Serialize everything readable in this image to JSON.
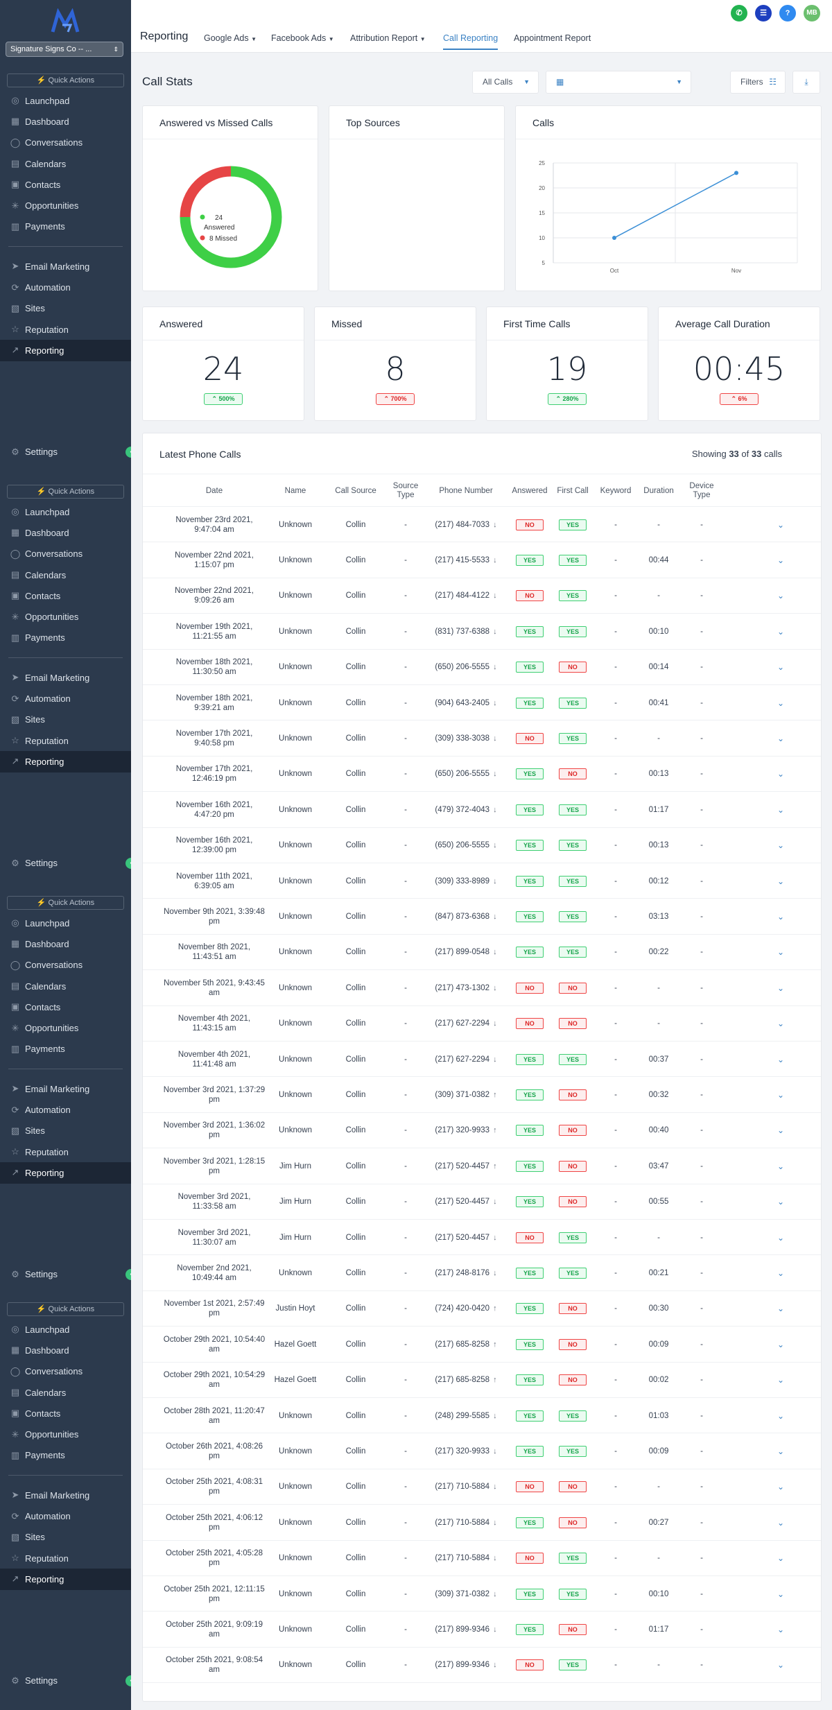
{
  "sidebar": {
    "logo": "MB",
    "account": "Signature Signs Co -- ...",
    "quick_actions": "Quick Actions",
    "group1": [
      {
        "label": "Launchpad",
        "icon": "launchpad-icon"
      },
      {
        "label": "Dashboard",
        "icon": "dashboard-icon"
      },
      {
        "label": "Conversations",
        "icon": "conversations-icon"
      },
      {
        "label": "Calendars",
        "icon": "calendar-icon"
      },
      {
        "label": "Contacts",
        "icon": "contacts-icon"
      },
      {
        "label": "Opportunities",
        "icon": "opportunities-icon"
      },
      {
        "label": "Payments",
        "icon": "payments-icon"
      }
    ],
    "group2": [
      {
        "label": "Email Marketing",
        "icon": "email-icon"
      },
      {
        "label": "Automation",
        "icon": "automation-icon"
      },
      {
        "label": "Sites",
        "icon": "sites-icon"
      },
      {
        "label": "Reputation",
        "icon": "star-icon"
      },
      {
        "label": "Reporting",
        "icon": "reporting-icon"
      }
    ],
    "settings": "Settings"
  },
  "topbar": {
    "title": "Reporting",
    "tabs": [
      "Google Ads",
      "Facebook Ads",
      "Attribution Report",
      "Call Reporting",
      "Appointment Report"
    ],
    "active_tab": 3,
    "avatar_initials": "MB",
    "help": "?"
  },
  "controls": {
    "page_title": "Call Stats",
    "call_filter": "All Calls",
    "filters_label": "Filters"
  },
  "cards": {
    "answered_vs_missed": {
      "title": "Answered vs Missed Calls",
      "answered_legend": "24 Answered",
      "missed_legend": "8 Missed",
      "answered": 24,
      "missed": 8
    },
    "top_sources": {
      "title": "Top Sources"
    },
    "calls": {
      "title": "Calls"
    }
  },
  "stats": [
    {
      "title": "Answered",
      "value": "24",
      "change": "500%",
      "dir": "up"
    },
    {
      "title": "Missed",
      "value": "8",
      "change": "700%",
      "dir": "down"
    },
    {
      "title": "First Time Calls",
      "value": "19",
      "change": "280%",
      "dir": "up"
    },
    {
      "title": "Average Call Duration",
      "value": "00:45",
      "change": "6%",
      "dir": "down"
    }
  ],
  "latest": {
    "title": "Latest Phone Calls",
    "showing_prefix": "Showing",
    "showing_count": "33",
    "showing_of": "of",
    "showing_total": "33",
    "showing_suffix": "calls",
    "columns": [
      "Date",
      "Name",
      "Call Source",
      "Source Type",
      "Phone Number",
      "Answered",
      "First Call",
      "Keyword",
      "Duration",
      "Device Type"
    ],
    "rows": [
      {
        "date": "November 23rd 2021, 9:47:04 am",
        "name": "Unknown",
        "source": "Collin",
        "type": "-",
        "phone": "(217) 484-7033",
        "dir": "in",
        "answered": "NO",
        "first": "YES",
        "keyword": "-",
        "duration": "-",
        "device": "-"
      },
      {
        "date": "November 22nd 2021, 1:15:07 pm",
        "name": "Unknown",
        "source": "Collin",
        "type": "-",
        "phone": "(217) 415-5533",
        "dir": "in",
        "answered": "YES",
        "first": "YES",
        "keyword": "-",
        "duration": "00:44",
        "device": "-"
      },
      {
        "date": "November 22nd 2021, 9:09:26 am",
        "name": "Unknown",
        "source": "Collin",
        "type": "-",
        "phone": "(217) 484-4122",
        "dir": "in",
        "answered": "NO",
        "first": "YES",
        "keyword": "-",
        "duration": "-",
        "device": "-"
      },
      {
        "date": "November 19th 2021, 11:21:55 am",
        "name": "Unknown",
        "source": "Collin",
        "type": "-",
        "phone": "(831) 737-6388",
        "dir": "in",
        "answered": "YES",
        "first": "YES",
        "keyword": "-",
        "duration": "00:10",
        "device": "-"
      },
      {
        "date": "November 18th 2021, 11:30:50 am",
        "name": "Unknown",
        "source": "Collin",
        "type": "-",
        "phone": "(650) 206-5555",
        "dir": "in",
        "answered": "YES",
        "first": "NO",
        "keyword": "-",
        "duration": "00:14",
        "device": "-"
      },
      {
        "date": "November 18th 2021, 9:39:21 am",
        "name": "Unknown",
        "source": "Collin",
        "type": "-",
        "phone": "(904) 643-2405",
        "dir": "in",
        "answered": "YES",
        "first": "YES",
        "keyword": "-",
        "duration": "00:41",
        "device": "-"
      },
      {
        "date": "November 17th 2021, 9:40:58 pm",
        "name": "Unknown",
        "source": "Collin",
        "type": "-",
        "phone": "(309) 338-3038",
        "dir": "in",
        "answered": "NO",
        "first": "YES",
        "keyword": "-",
        "duration": "-",
        "device": "-"
      },
      {
        "date": "November 17th 2021, 12:46:19 pm",
        "name": "Unknown",
        "source": "Collin",
        "type": "-",
        "phone": "(650) 206-5555",
        "dir": "in",
        "answered": "YES",
        "first": "NO",
        "keyword": "-",
        "duration": "00:13",
        "device": "-"
      },
      {
        "date": "November 16th 2021, 4:47:20 pm",
        "name": "Unknown",
        "source": "Collin",
        "type": "-",
        "phone": "(479) 372-4043",
        "dir": "in",
        "answered": "YES",
        "first": "YES",
        "keyword": "-",
        "duration": "01:17",
        "device": "-"
      },
      {
        "date": "November 16th 2021, 12:39:00 pm",
        "name": "Unknown",
        "source": "Collin",
        "type": "-",
        "phone": "(650) 206-5555",
        "dir": "in",
        "answered": "YES",
        "first": "YES",
        "keyword": "-",
        "duration": "00:13",
        "device": "-"
      },
      {
        "date": "November 11th 2021, 6:39:05 am",
        "name": "Unknown",
        "source": "Collin",
        "type": "-",
        "phone": "(309) 333-8989",
        "dir": "in",
        "answered": "YES",
        "first": "YES",
        "keyword": "-",
        "duration": "00:12",
        "device": "-"
      },
      {
        "date": "November 9th 2021, 3:39:48 pm",
        "name": "Unknown",
        "source": "Collin",
        "type": "-",
        "phone": "(847) 873-6368",
        "dir": "in",
        "answered": "YES",
        "first": "YES",
        "keyword": "-",
        "duration": "03:13",
        "device": "-"
      },
      {
        "date": "November 8th 2021, 11:43:51 am",
        "name": "Unknown",
        "source": "Collin",
        "type": "-",
        "phone": "(217) 899-0548",
        "dir": "in",
        "answered": "YES",
        "first": "YES",
        "keyword": "-",
        "duration": "00:22",
        "device": "-"
      },
      {
        "date": "November 5th 2021, 9:43:45 am",
        "name": "Unknown",
        "source": "Collin",
        "type": "-",
        "phone": "(217) 473-1302",
        "dir": "in",
        "answered": "NO",
        "first": "NO",
        "keyword": "-",
        "duration": "-",
        "device": "-"
      },
      {
        "date": "November 4th 2021, 11:43:15 am",
        "name": "Unknown",
        "source": "Collin",
        "type": "-",
        "phone": "(217) 627-2294",
        "dir": "in",
        "answered": "NO",
        "first": "NO",
        "keyword": "-",
        "duration": "-",
        "device": "-"
      },
      {
        "date": "November 4th 2021, 11:41:48 am",
        "name": "Unknown",
        "source": "Collin",
        "type": "-",
        "phone": "(217) 627-2294",
        "dir": "in",
        "answered": "YES",
        "first": "YES",
        "keyword": "-",
        "duration": "00:37",
        "device": "-"
      },
      {
        "date": "November 3rd 2021, 1:37:29 pm",
        "name": "Unknown",
        "source": "Collin",
        "type": "-",
        "phone": "(309) 371-0382",
        "dir": "out",
        "answered": "YES",
        "first": "NO",
        "keyword": "-",
        "duration": "00:32",
        "device": "-"
      },
      {
        "date": "November 3rd 2021, 1:36:02 pm",
        "name": "Unknown",
        "source": "Collin",
        "type": "-",
        "phone": "(217) 320-9933",
        "dir": "out",
        "answered": "YES",
        "first": "NO",
        "keyword": "-",
        "duration": "00:40",
        "device": "-"
      },
      {
        "date": "November 3rd 2021, 1:28:15 pm",
        "name": "Jim Hurn",
        "source": "Collin",
        "type": "-",
        "phone": "(217) 520-4457",
        "dir": "out",
        "answered": "YES",
        "first": "NO",
        "keyword": "-",
        "duration": "03:47",
        "device": "-"
      },
      {
        "date": "November 3rd 2021, 11:33:58 am",
        "name": "Jim Hurn",
        "source": "Collin",
        "type": "-",
        "phone": "(217) 520-4457",
        "dir": "in",
        "answered": "YES",
        "first": "NO",
        "keyword": "-",
        "duration": "00:55",
        "device": "-"
      },
      {
        "date": "November 3rd 2021, 11:30:07 am",
        "name": "Jim Hurn",
        "source": "Collin",
        "type": "-",
        "phone": "(217) 520-4457",
        "dir": "in",
        "answered": "NO",
        "first": "YES",
        "keyword": "-",
        "duration": "-",
        "device": "-"
      },
      {
        "date": "November 2nd 2021, 10:49:44 am",
        "name": "Unknown",
        "source": "Collin",
        "type": "-",
        "phone": "(217) 248-8176",
        "dir": "in",
        "answered": "YES",
        "first": "YES",
        "keyword": "-",
        "duration": "00:21",
        "device": "-"
      },
      {
        "date": "November 1st 2021, 2:57:49 pm",
        "name": "Justin Hoyt",
        "source": "Collin",
        "type": "-",
        "phone": "(724) 420-0420",
        "dir": "out",
        "answered": "YES",
        "first": "NO",
        "keyword": "-",
        "duration": "00:30",
        "device": "-"
      },
      {
        "date": "October 29th 2021, 10:54:40 am",
        "name": "Hazel Goett",
        "source": "Collin",
        "type": "-",
        "phone": "(217) 685-8258",
        "dir": "out",
        "answered": "YES",
        "first": "NO",
        "keyword": "-",
        "duration": "00:09",
        "device": "-"
      },
      {
        "date": "October 29th 2021, 10:54:29 am",
        "name": "Hazel Goett",
        "source": "Collin",
        "type": "-",
        "phone": "(217) 685-8258",
        "dir": "out",
        "answered": "YES",
        "first": "NO",
        "keyword": "-",
        "duration": "00:02",
        "device": "-"
      },
      {
        "date": "October 28th 2021, 11:20:47 am",
        "name": "Unknown",
        "source": "Collin",
        "type": "-",
        "phone": "(248) 299-5585",
        "dir": "in",
        "answered": "YES",
        "first": "YES",
        "keyword": "-",
        "duration": "01:03",
        "device": "-"
      },
      {
        "date": "October 26th 2021, 4:08:26 pm",
        "name": "Unknown",
        "source": "Collin",
        "type": "-",
        "phone": "(217) 320-9933",
        "dir": "in",
        "answered": "YES",
        "first": "YES",
        "keyword": "-",
        "duration": "00:09",
        "device": "-"
      },
      {
        "date": "October 25th 2021, 4:08:31 pm",
        "name": "Unknown",
        "source": "Collin",
        "type": "-",
        "phone": "(217) 710-5884",
        "dir": "in",
        "answered": "NO",
        "first": "NO",
        "keyword": "-",
        "duration": "-",
        "device": "-"
      },
      {
        "date": "October 25th 2021, 4:06:12 pm",
        "name": "Unknown",
        "source": "Collin",
        "type": "-",
        "phone": "(217) 710-5884",
        "dir": "in",
        "answered": "YES",
        "first": "NO",
        "keyword": "-",
        "duration": "00:27",
        "device": "-"
      },
      {
        "date": "October 25th 2021, 4:05:28 pm",
        "name": "Unknown",
        "source": "Collin",
        "type": "-",
        "phone": "(217) 710-5884",
        "dir": "in",
        "answered": "NO",
        "first": "YES",
        "keyword": "-",
        "duration": "-",
        "device": "-"
      },
      {
        "date": "October 25th 2021, 12:11:15 pm",
        "name": "Unknown",
        "source": "Collin",
        "type": "-",
        "phone": "(309) 371-0382",
        "dir": "in",
        "answered": "YES",
        "first": "YES",
        "keyword": "-",
        "duration": "00:10",
        "device": "-"
      },
      {
        "date": "October 25th 2021, 9:09:19 am",
        "name": "Unknown",
        "source": "Collin",
        "type": "-",
        "phone": "(217) 899-9346",
        "dir": "in",
        "answered": "YES",
        "first": "NO",
        "keyword": "-",
        "duration": "01:17",
        "device": "-"
      },
      {
        "date": "October 25th 2021, 9:08:54 am",
        "name": "Unknown",
        "source": "Collin",
        "type": "-",
        "phone": "(217) 899-9346",
        "dir": "in",
        "answered": "NO",
        "first": "YES",
        "keyword": "-",
        "duration": "-",
        "device": "-"
      }
    ]
  },
  "chart_data": [
    {
      "type": "pie",
      "title": "Answered vs Missed Calls",
      "categories": [
        "Answered",
        "Missed"
      ],
      "values": [
        24,
        8
      ],
      "colors": [
        "#3ecf46",
        "#e64545"
      ]
    },
    {
      "type": "line",
      "title": "Calls",
      "categories": [
        "Oct",
        "Nov"
      ],
      "series": [
        {
          "values": [
            10,
            23
          ]
        }
      ],
      "ylim": [
        5,
        25
      ],
      "yticks": [
        5,
        10,
        15,
        20,
        25
      ],
      "grid": true,
      "color": "#3b8fd6"
    }
  ],
  "colors": {
    "sidebar": "#2c3a4d",
    "accent": "#3b82c4",
    "green": "#3ecf72",
    "red": "#e64545"
  }
}
